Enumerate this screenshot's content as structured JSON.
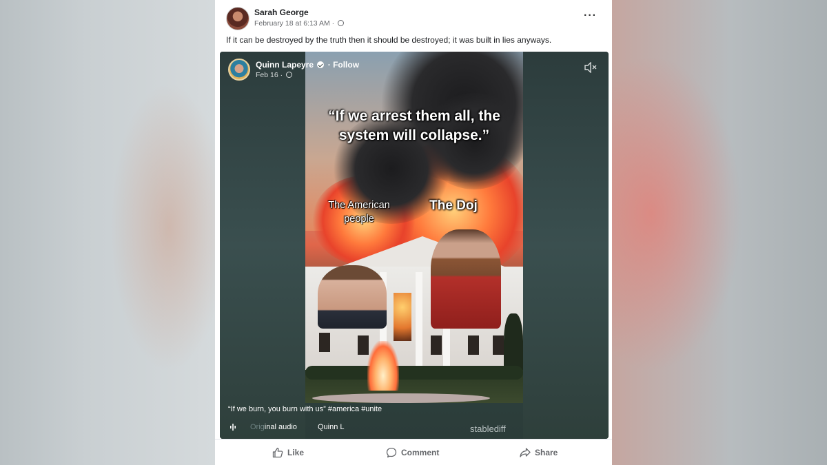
{
  "post": {
    "author": "Sarah George",
    "timestamp": "February 18 at 6:13 AM",
    "privacy_icon": "globe-icon",
    "text": "If it can be destroyed by the truth then it should be destroyed; it was built in lies anyways.",
    "more_icon": "more-options-icon"
  },
  "embedded": {
    "author": "Quinn Lapeyre",
    "follow_label": "Follow",
    "date": "Feb 16",
    "meme": {
      "quote": "“If we arrest them all, the system will collapse.”",
      "label_left": "The American people",
      "label_right": "The Doj"
    },
    "caption": "“If we burn, you burn with us” #america #unite",
    "audio": {
      "label_faded": "Orig",
      "label_rest": "inal audio",
      "author": "Quinn L"
    },
    "watermark": "stablediff"
  },
  "actions": {
    "like": "Like",
    "comment": "Comment",
    "share": "Share"
  },
  "colors": {
    "link_gray": "#65676b",
    "text_dark": "#1c1e21",
    "media_bg": "#344848"
  }
}
